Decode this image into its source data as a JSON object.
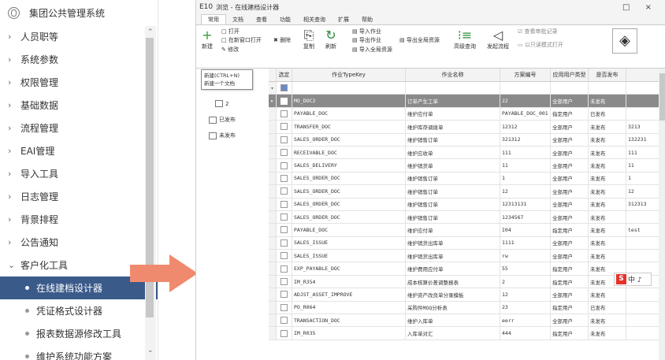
{
  "nav": {
    "title": "集团公共管理系统",
    "items": [
      {
        "label": "人员职等",
        "chev": "›"
      },
      {
        "label": "系统参数",
        "chev": "›"
      },
      {
        "label": "权限管理",
        "chev": "›"
      },
      {
        "label": "基础数据",
        "chev": "›"
      },
      {
        "label": "流程管理",
        "chev": "›"
      },
      {
        "label": "EAI管理",
        "chev": "›"
      },
      {
        "label": "导入工具",
        "chev": "›"
      },
      {
        "label": "日志管理",
        "chev": "›"
      },
      {
        "label": "背景排程",
        "chev": "›"
      },
      {
        "label": "公告通知",
        "chev": "›"
      },
      {
        "label": "客户化工具",
        "chev": "⌄"
      }
    ],
    "subitems": [
      {
        "label": "在线建档设计器"
      },
      {
        "label": "凭证格式设计器"
      },
      {
        "label": "报表数据源修改工具"
      },
      {
        "label": "维护系统功能方案"
      }
    ]
  },
  "window": {
    "logo": "E10",
    "title": "浏览 - 在线建档设计器",
    "controls": "□ ×",
    "menus": [
      "常用",
      "文档",
      "查看",
      "功能",
      "相关查询",
      "扩展",
      "帮助"
    ]
  },
  "ribbon": {
    "new": "新建",
    "open": "打开",
    "open_new_window": "在新窗口打开",
    "edit": "修改",
    "delete": "删除",
    "copy": "复制",
    "refresh": "刷新",
    "import_job": "导入作业",
    "export_job": "导出作业",
    "import_all": "导入全局资源",
    "export_all": "导出全局资源",
    "advanced_query": "高级查询",
    "send_flow": "发起流程",
    "view_approval": "查看审批记录",
    "open_readonly": "以只读模式打开"
  },
  "tooltip": {
    "title": "新建(CTRL+N)",
    "desc": "新建一个文档"
  },
  "tree": {
    "nodes": [
      {
        "label": "2"
      },
      {
        "label": "已发布"
      },
      {
        "label": "未发布"
      }
    ]
  },
  "grid": {
    "headers": [
      "选定",
      "作业TypeKey",
      "作业名称",
      "方案编号",
      "应用用户类型",
      "是否发布",
      ""
    ],
    "rows": [
      [
        "",
        "MO_DOC2",
        "订单产生工单",
        "22",
        "全部用户",
        "未发布",
        ""
      ],
      [
        "",
        "PAYABLE_DOC",
        "维护应付单",
        "PAYABLE_DOC_001",
        "指定用户",
        "已发布",
        ""
      ],
      [
        "",
        "TRANSFER_DOC",
        "维护库存调拨单",
        "12312",
        "全部用户",
        "未发布",
        "3213"
      ],
      [
        "",
        "SALES_ORDER_DOC",
        "维护销售订单",
        "321312",
        "全部用户",
        "未发布",
        "132231"
      ],
      [
        "",
        "RECEIVABLE_DOC",
        "维护应收单",
        "111",
        "全部用户",
        "未发布",
        "111"
      ],
      [
        "",
        "SALES_DELIVERY",
        "维护销货单",
        "11",
        "全部用户",
        "未发布",
        "11"
      ],
      [
        "",
        "SALES_ORDER_DOC",
        "维护销售订单",
        "1",
        "全部用户",
        "未发布",
        "1"
      ],
      [
        "",
        "SALES_ORDER_DOC",
        "维护销售订单",
        "12",
        "全部用户",
        "未发布",
        "12"
      ],
      [
        "",
        "SALES_ORDER_DOC",
        "维护销售订单",
        "12313131",
        "全部用户",
        "未发布",
        "312313"
      ],
      [
        "",
        "SALES_ORDER_DOC",
        "维护销售订单",
        "1234567",
        "全部用户",
        "未发布",
        ""
      ],
      [
        "",
        "PAYABLE_DOC",
        "维护应付单",
        "I04",
        "指定用户",
        "未发布",
        "test"
      ],
      [
        "",
        "SALES_ISSUE",
        "维护销货出库单",
        "1111",
        "全部用户",
        "未发布",
        ""
      ],
      [
        "",
        "SALES_ISSUE",
        "维护销货出库单",
        "rw",
        "全部用户",
        "未发布",
        ""
      ],
      [
        "",
        "EXP_PAYABLE_DOC",
        "维护费用应付单",
        "55",
        "指定用户",
        "未发布",
        ""
      ],
      [
        "",
        "IM_R354",
        "成本核算价差调整报表",
        "2",
        "指定用户",
        "未发布",
        ""
      ],
      [
        "",
        "ADJST_ASSET_IMPROVE",
        "维护资产改良单分录模板",
        "12",
        "全部用户",
        "未发布",
        ""
      ],
      [
        "",
        "PO_R064",
        "采购件MOQ分析表",
        "23",
        "指定用户",
        "已发布",
        ""
      ],
      [
        "",
        "TRANSACTION_DOC",
        "维护入库单",
        "eerr",
        "全部用户",
        "未发布",
        ""
      ],
      [
        "",
        "IM_R035",
        "入库单对汇",
        "444",
        "指定用户",
        "未发布",
        ""
      ]
    ]
  },
  "ime": {
    "logo": "S",
    "text": "中 ♪"
  }
}
